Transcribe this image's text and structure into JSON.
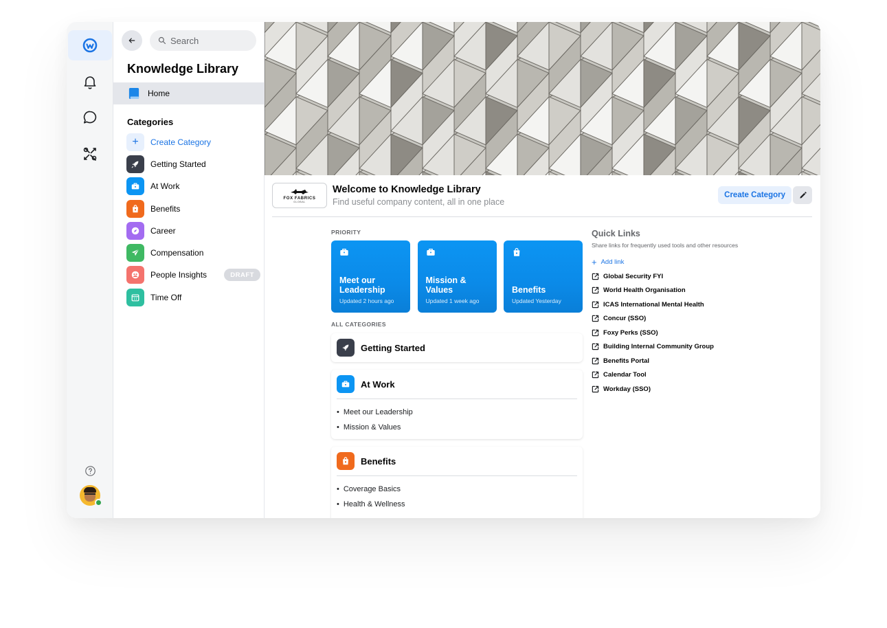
{
  "search": {
    "placeholder": "Search"
  },
  "sidebar": {
    "title": "Knowledge Library",
    "home_label": "Home",
    "categories_heading": "Categories",
    "create_category_label": "Create Category",
    "categories": [
      {
        "label": "Getting Started",
        "icon": "rocket-icon",
        "color": "#3a3f4b"
      },
      {
        "label": "At Work",
        "icon": "briefcase-icon",
        "color": "#0c95f3"
      },
      {
        "label": "Benefits",
        "icon": "shopping-bag-icon",
        "color": "#f06a1d"
      },
      {
        "label": "Career",
        "icon": "compass-icon",
        "color": "#a36cf1"
      },
      {
        "label": "Compensation",
        "icon": "paper-plane-icon",
        "color": "#3fb963"
      },
      {
        "label": "People Insights",
        "icon": "people-icon",
        "color": "#f4736d",
        "badge": "DRAFT"
      },
      {
        "label": "Time Off",
        "icon": "calendar-icon",
        "color": "#2ebfa0"
      }
    ]
  },
  "header": {
    "logo_text": "FOX FABRICS",
    "logo_subtext": "GLOBAL",
    "title": "Welcome to Knowledge Library",
    "subtitle": "Find useful company content, all in one place",
    "create_button": "Create Category"
  },
  "priority": {
    "label": "PRIORITY",
    "cards": [
      {
        "title": "Meet our Leadership",
        "updated": "Updated 2 hours ago",
        "icon": "briefcase-icon"
      },
      {
        "title": "Mission & Values",
        "updated": "Updated 1 week ago",
        "icon": "briefcase-icon"
      },
      {
        "title": "Benefits",
        "updated": "Updated Yesterday",
        "icon": "shopping-bag-icon"
      }
    ]
  },
  "all_categories": {
    "label": "ALL CATEGORIES",
    "cards": [
      {
        "title": "Getting Started",
        "icon": "rocket-icon",
        "color": "#3a3f4b",
        "items": []
      },
      {
        "title": "At Work",
        "icon": "briefcase-icon",
        "color": "#0c95f3",
        "items": [
          "Meet our Leadership",
          "Mission & Values"
        ]
      },
      {
        "title": "Benefits",
        "icon": "shopping-bag-icon",
        "color": "#f06a1d",
        "items": [
          "Coverage Basics",
          "Health & Wellness"
        ]
      }
    ]
  },
  "quick_links": {
    "title": "Quick Links",
    "subtitle": "Share links for frequently used tools and other resources",
    "add_label": "Add link",
    "links": [
      "Global Security FYI",
      "World Health Organisation",
      "ICAS International Mental Health",
      "Concur (SSO)",
      "Foxy Perks (SSO)",
      "Building Internal Community Group",
      "Benefits Portal",
      "Calendar Tool",
      "Workday (SSO)"
    ]
  },
  "colors": {
    "accent": "#1b74e4",
    "card_blue": "#0c95f3"
  }
}
